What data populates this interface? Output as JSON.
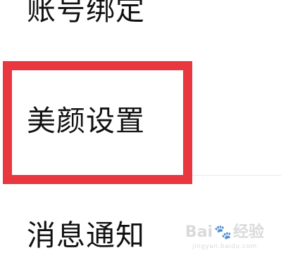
{
  "settings": {
    "items": [
      {
        "label": "账号绑定"
      },
      {
        "label": "美颜设置"
      },
      {
        "label": "消息通知"
      }
    ]
  },
  "highlight": {
    "target": "美颜设置",
    "color": "#e8373f"
  },
  "watermark": {
    "brand": "Bai",
    "suffix": "经验",
    "url": "jingyan.baidu.com"
  }
}
